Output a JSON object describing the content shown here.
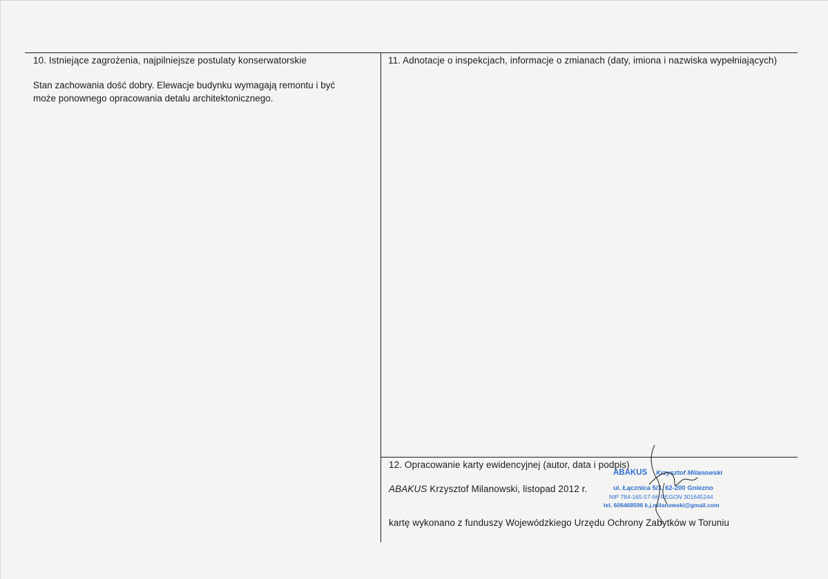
{
  "section10": {
    "title": "10. Istniejące zagrożenia, najpilniejsze postulaty konserwatorskie",
    "body": "Stan zachowania dość dobry. Elewacje budynku wymagają remontu i być może ponownego opracowania detalu architektonicznego."
  },
  "section11": {
    "title": "11. Adnotacje o inspekcjach, informacje o zmianach (daty, imiona i nazwiska wypełniających)"
  },
  "section12": {
    "title": "12. Opracowanie karty ewidencyjnej (autor, data i podpis)",
    "author_firm": "ABAKUS",
    "author_rest": " Krzysztof Milanowski, listopad 2012 r.",
    "funding": "kartę wykonano z funduszy Wojewódzkiego Urzędu Ochrony Zabytków w Toruniu"
  },
  "stamp": {
    "firm": "ABAKUS",
    "owner": "Krzysztof Milanowski",
    "address": "ul. Łącznica 5/3, 62-200 Gniezno",
    "nip_regon": "NIP 784-165-57-66  REGON 301645244",
    "contact": "tel. 606468596  k.j.milanowski@gmail.com",
    "color": "#2f6fd0"
  }
}
